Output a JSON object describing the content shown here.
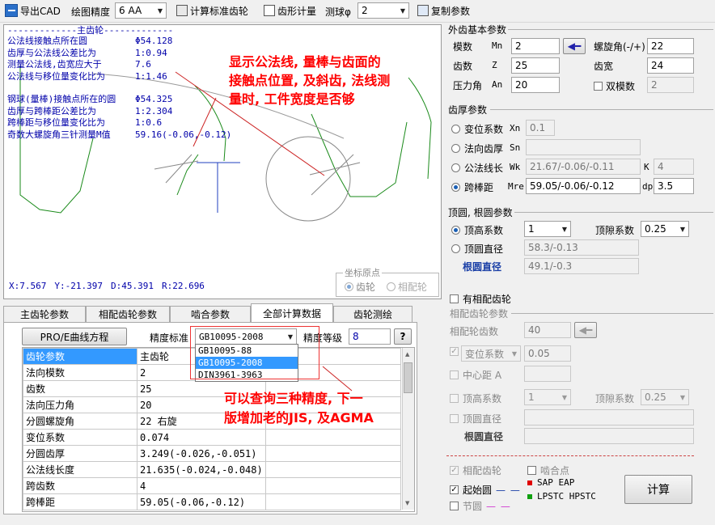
{
  "toolbar": {
    "export_cad": "导出CAD",
    "precision_label": "绘图精度",
    "precision_value": "6  AA",
    "calc_gear": "计算标准齿轮",
    "tooth_measure": "齿形计量",
    "measure_phi_label": "测球φ",
    "measure_phi_value": "2",
    "copy_params": "复制参数"
  },
  "canvas": {
    "divider": "-------------主齿轮-------------",
    "info_rows": [
      {
        "label": "公法线接触点所在圆",
        "value": "Φ54.128"
      },
      {
        "label": "齿厚与公法线公差比为",
        "value": "1:0.94"
      },
      {
        "label": "测量公法线,齿宽应大于",
        "value": "7.6"
      },
      {
        "label": "公法线与移位量变化比为",
        "value": "1:1.46"
      },
      {
        "label": "钢球(量棒)接触点所在的圆",
        "value": "Φ54.325"
      },
      {
        "label": "齿厚与跨棒距公差比为",
        "value": "1:2.304"
      },
      {
        "label": "跨棒距与移位量变化比为",
        "value": "1:0.6"
      },
      {
        "label": "奇数大螺旋角三针测量M值",
        "value": "59.16(-0.06,-0.12)"
      }
    ],
    "annotation": [
      "显示公法线, 量棒与齿面的",
      "接触点位置, 及斜齿, 法线测",
      "量时, 工件宽度是否够"
    ],
    "coords": {
      "x": "X:7.567",
      "y": "Y:-21.397",
      "d": "D:45.391",
      "r": "R:22.696"
    },
    "origin_title": "坐标原点",
    "origin_gear": "齿轮",
    "origin_mate": "相配轮"
  },
  "tabs": [
    "主齿轮参数",
    "相配齿轮参数",
    "啮合参数",
    "全部计算数据",
    "齿轮测绘"
  ],
  "data_tab": {
    "pro_e_button": "PRO/E曲线方程",
    "standard_label": "精度标准",
    "standard_value": "GB10095-2008",
    "standard_options": [
      "GB10095-88",
      "GB10095-2008",
      "DIN3961-3963"
    ],
    "grade_label": "精度等级",
    "grade_value": "8",
    "help": "?",
    "table_header": [
      "齿轮参数",
      "主齿轮"
    ],
    "rows": [
      [
        "法向模数",
        "2"
      ],
      [
        "齿数",
        "25"
      ],
      [
        "法向压力角",
        "20"
      ],
      [
        "分圆螺旋角",
        "22  右旋"
      ],
      [
        "变位系数",
        "0.074"
      ],
      [
        "分圆齿厚",
        "3.249(-0.026,-0.051)"
      ],
      [
        "公法线长度",
        "21.635(-0.024,-0.048)"
      ],
      [
        "跨齿数",
        "4"
      ],
      [
        "跨棒距",
        "59.05(-0.06,-0.12)"
      ]
    ],
    "annotation": [
      "可以查询三种精度, 下一",
      "版增加老的JIS, 及AGMA"
    ]
  },
  "right": {
    "ext_title": "外齿基本参数",
    "module_label": "模数",
    "module_sym": "Mn",
    "module_value": "2",
    "helix_label": "螺旋角(-/+)",
    "helix_value": "22",
    "teeth_label": "齿数",
    "teeth_sym": "Z",
    "teeth_value": "25",
    "width_label": "齿宽",
    "width_value": "24",
    "pressure_label": "压力角",
    "pressure_sym": "An",
    "pressure_value": "20",
    "double_module": "双模数",
    "double_value": "2",
    "thick_title": "齿厚参数",
    "shift_label": "变位系数",
    "shift_sym": "Xn",
    "shift_value": "0.1",
    "normal_thick_label": "法向齿厚",
    "normal_thick_sym": "Sn",
    "wk_label": "公法线长",
    "wk_sym": "Wk",
    "wk_value": "21.67/-0.06/-0.11",
    "k_sym": "K",
    "k_value": "4",
    "mre_label": "跨棒距",
    "mre_sym": "Mre",
    "mre_value": "59.05/-0.06/-0.12",
    "dp_sym": "dp",
    "dp_value": "3.5",
    "tip_title": "顶圆, 根圆参数",
    "addendum_label": "顶高系数",
    "addendum_value": "1",
    "clearance_label": "顶隙系数",
    "clearance_value": "0.25",
    "tip_dia_label": "顶圆直径",
    "tip_dia_value": "58.3/-0.13",
    "root_dia_label": "根圆直径",
    "root_dia_value": "49.1/-0.3",
    "has_mate": "有相配齿轮",
    "mate_title": "相配齿轮参数",
    "mate_teeth_label": "相配轮齿数",
    "mate_teeth_value": "40",
    "mate_shift_label": "变位系数",
    "mate_shift_value": "0.05",
    "center_label": "中心距 A",
    "mate_addendum_label": "顶高系数",
    "mate_addendum_value": "1",
    "mate_clearance_label": "顶隙系数",
    "mate_clearance_value": "0.25",
    "mate_tip_label": "顶圆直径",
    "mate_root_label": "根圆直径",
    "legend_mate_gear": "相配齿轮",
    "legend_mesh_point": "啮合点",
    "legend_start_circle": "起始圆",
    "legend_sap": "SAP  EAP",
    "legend_lpstc": "LPSTC HPSTC",
    "legend_pitch": "节圆",
    "calc_button": "计算"
  },
  "colors": {
    "gear_line": "#1a8a1a",
    "info_text": "#0000aa",
    "annotation": "#ff0000",
    "highlight": "#3399ff"
  }
}
